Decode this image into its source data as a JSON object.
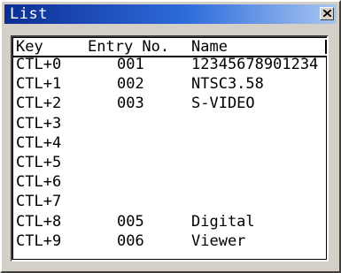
{
  "window": {
    "title": "List",
    "close_glyph": "×"
  },
  "columns": {
    "key": "Key",
    "entry": "Entry No.",
    "name": "Name"
  },
  "rows": [
    {
      "key": "CTL+0",
      "entry": "001",
      "name": "12345678901234"
    },
    {
      "key": "CTL+1",
      "entry": "002",
      "name": "NTSC3.58"
    },
    {
      "key": "CTL+2",
      "entry": "003",
      "name": "S-VIDEO"
    },
    {
      "key": "CTL+3",
      "entry": "",
      "name": ""
    },
    {
      "key": "CTL+4",
      "entry": "",
      "name": ""
    },
    {
      "key": "CTL+5",
      "entry": "",
      "name": ""
    },
    {
      "key": "CTL+6",
      "entry": "",
      "name": ""
    },
    {
      "key": "CTL+7",
      "entry": "",
      "name": ""
    },
    {
      "key": "CTL+8",
      "entry": "005",
      "name": "Digital"
    },
    {
      "key": "CTL+9",
      "entry": "006",
      "name": "Viewer"
    }
  ]
}
